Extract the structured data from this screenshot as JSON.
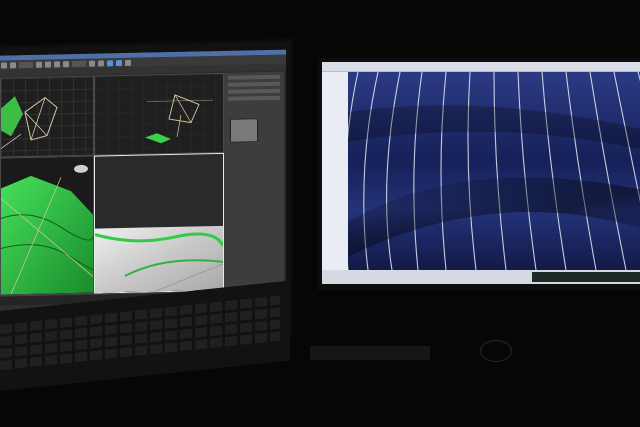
{
  "scene": {
    "description_colors": {
      "background": "#060606",
      "viewport_green": "#2fd646",
      "fabric_navy": "#1d2a66",
      "pinstripe": "#e6e9f2",
      "app_accent": "#5b8fd6"
    }
  },
  "left_monitor": {
    "app": "3d-modeling-software",
    "viewports": [
      "top-left",
      "top-right",
      "perspective-bottom-left",
      "render-bottom-right"
    ],
    "toolbar_icons": [
      "undo-icon",
      "redo-icon",
      "select-icon",
      "move-icon",
      "rotate-icon",
      "scale-icon",
      "render-icon"
    ]
  },
  "right_monitor": {
    "app": "image-viewer",
    "image": "pinstripe-fabric-photo"
  }
}
